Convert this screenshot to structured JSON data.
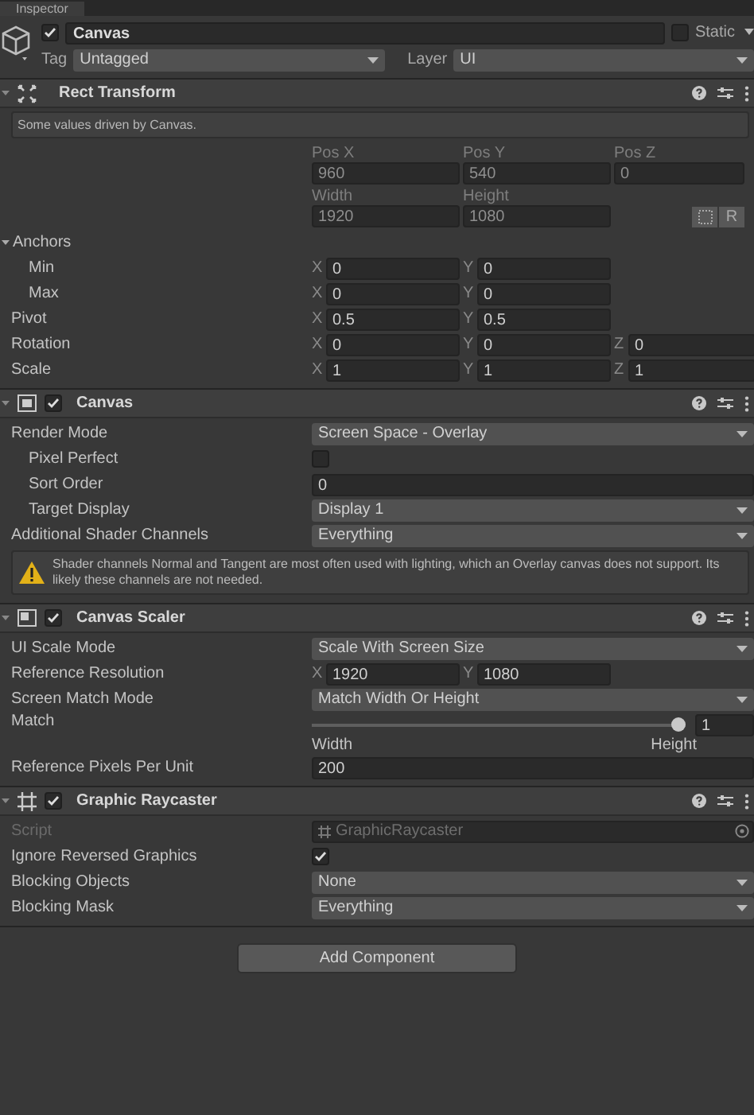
{
  "tab": {
    "title": "Inspector"
  },
  "object": {
    "active": true,
    "name": "Canvas",
    "static": false,
    "static_label": "Static",
    "tag_label": "Tag",
    "tag": "Untagged",
    "layer_label": "Layer",
    "layer": "UI"
  },
  "components": [
    {
      "kind": "rect-transform",
      "title": "Rect Transform",
      "expanded": true,
      "rows": [
        {
          "kind": "info",
          "text": "Some values driven by Canvas."
        },
        {
          "kind": "field-grid",
          "fields": [
            {
              "label": "Pos X",
              "value": "960"
            },
            {
              "label": "Pos Y",
              "value": "540"
            },
            {
              "label": "Pos Z",
              "value": "0"
            }
          ]
        },
        {
          "kind": "field-grid",
          "fields": [
            {
              "label": "Width",
              "value": "1920"
            },
            {
              "label": "Height",
              "value": "1080"
            }
          ],
          "raw_button": "R"
        },
        {
          "kind": "group",
          "label": "Anchors",
          "expanded": true,
          "children": [
            {
              "kind": "vector",
              "label": "Min",
              "axes": [
                {
                  "axis": "X",
                  "value": "0"
                },
                {
                  "axis": "Y",
                  "value": "0"
                }
              ]
            },
            {
              "kind": "vector",
              "label": "Max",
              "axes": [
                {
                  "axis": "X",
                  "value": "0"
                },
                {
                  "axis": "Y",
                  "value": "0"
                }
              ]
            }
          ]
        },
        {
          "kind": "vector",
          "label": "Pivot",
          "axes": [
            {
              "axis": "X",
              "value": "0.5"
            },
            {
              "axis": "Y",
              "value": "0.5"
            }
          ]
        },
        {
          "kind": "vector",
          "label": "Rotation",
          "axes": [
            {
              "axis": "X",
              "value": "0"
            },
            {
              "axis": "Y",
              "value": "0"
            },
            {
              "axis": "Z",
              "value": "0"
            }
          ]
        },
        {
          "kind": "vector",
          "label": "Scale",
          "axes": [
            {
              "axis": "X",
              "value": "1"
            },
            {
              "axis": "Y",
              "value": "1"
            },
            {
              "axis": "Z",
              "value": "1"
            }
          ]
        }
      ]
    },
    {
      "kind": "canvas",
      "title": "Canvas",
      "enabled": true,
      "expanded": true,
      "rows": [
        {
          "kind": "dropdown",
          "label": "Render Mode",
          "value": "Screen Space - Overlay",
          "children": [
            {
              "kind": "checkbox",
              "label": "Pixel Perfect",
              "checked": false
            },
            {
              "kind": "text",
              "label": "Sort Order",
              "value": "0"
            },
            {
              "kind": "dropdown",
              "label": "Target Display",
              "value": "Display 1"
            }
          ]
        },
        {
          "kind": "dropdown",
          "label": "Additional Shader Channels",
          "value": "Everything"
        },
        {
          "kind": "warning",
          "text": "Shader channels Normal and Tangent are most often used with lighting, which an Overlay canvas does not support. Its likely these channels are not needed."
        }
      ]
    },
    {
      "kind": "canvas-scaler",
      "title": "Canvas Scaler",
      "enabled": true,
      "expanded": true,
      "rows": [
        {
          "kind": "dropdown",
          "label": "UI Scale Mode",
          "value": "Scale With Screen Size"
        },
        {
          "kind": "vector",
          "label": "Reference Resolution",
          "axes": [
            {
              "axis": "X",
              "value": "1920"
            },
            {
              "axis": "Y",
              "value": "1080"
            }
          ]
        },
        {
          "kind": "dropdown",
          "label": "Screen Match Mode",
          "value": "Match Width Or Height"
        },
        {
          "kind": "slider",
          "label": "Match",
          "level": 1,
          "value": "1",
          "min_label": "Width",
          "max_label": "Height"
        },
        {
          "kind": "text",
          "label": "Reference Pixels Per Unit",
          "value": "200"
        }
      ]
    },
    {
      "kind": "graphic-raycaster",
      "title": "Graphic Raycaster",
      "enabled": true,
      "expanded": true,
      "rows": [
        {
          "kind": "object",
          "label": "Script",
          "value": "GraphicRaycaster",
          "disabled": true
        },
        {
          "kind": "checkbox",
          "label": "Ignore Reversed Graphics",
          "checked": true
        },
        {
          "kind": "dropdown",
          "label": "Blocking Objects",
          "value": "None"
        },
        {
          "kind": "dropdown",
          "label": "Blocking Mask",
          "value": "Everything"
        }
      ]
    }
  ],
  "add_button": "Add Component"
}
